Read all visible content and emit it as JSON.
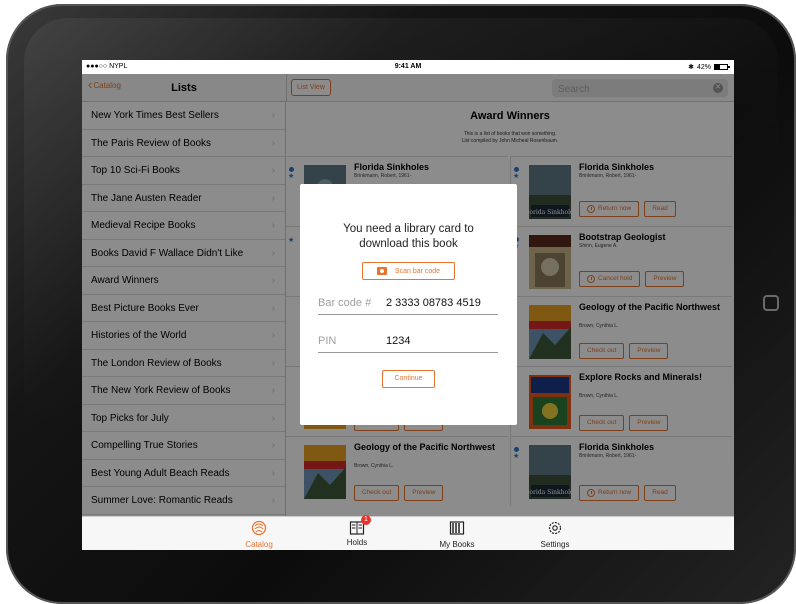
{
  "status_bar": {
    "carrier": "●●●○○ NYPL",
    "time": "9:41 AM",
    "battery": "42%"
  },
  "left_nav": {
    "back_label": "Catalog",
    "title": "Lists"
  },
  "right_nav": {
    "list_view_label": "List View",
    "search_placeholder": "Search"
  },
  "sidebar": {
    "items": [
      {
        "label": "New York Times Best Sellers"
      },
      {
        "label": "The Paris Review of Books"
      },
      {
        "label": "Top 10 Sci-Fi Books"
      },
      {
        "label": "The Jane Austen Reader"
      },
      {
        "label": "Medieval Recipe Books"
      },
      {
        "label": "Books David F Wallace Didn't Like"
      },
      {
        "label": "Award Winners"
      },
      {
        "label": "Best Picture Books Ever"
      },
      {
        "label": "Histories of the World"
      },
      {
        "label": "The London Review of Books"
      },
      {
        "label": "The New York Review of Books"
      },
      {
        "label": "Top Picks for July"
      },
      {
        "label": "Compelling True Stories"
      },
      {
        "label": "Best Young Adult Beach Reads"
      },
      {
        "label": "Summer Love: Romantic Reads"
      }
    ]
  },
  "main": {
    "title": "Award Winners",
    "subtitle_line1": "This is a list of books that won something.",
    "subtitle_line2": "List compiled by John Micheal Rosenbaum.",
    "books": [
      {
        "title": "Florida Sinkholes",
        "author": "Brinkmann, Robert, 1961-",
        "buttons": []
      },
      {
        "title": "Florida Sinkholes",
        "author": "Brinkmann, Robert, 1961-",
        "buttons": [
          "Return now",
          "Read"
        ]
      },
      {
        "title": "",
        "author": "",
        "buttons": []
      },
      {
        "title": "Bootstrap Geologist",
        "author": "Shinn, Eugene A.",
        "buttons": [
          "Cancel hold",
          "Preview"
        ]
      },
      {
        "title": "",
        "author": "",
        "buttons": []
      },
      {
        "title": "Geology of the Pacific Northwest",
        "author": "Brown, Cynthia L.",
        "buttons": [
          "Check out",
          "Preview"
        ]
      },
      {
        "title": "",
        "author": "",
        "buttons": [
          "Check out",
          "Preview"
        ]
      },
      {
        "title": "Explore Rocks and Minerals!",
        "author": "Brown, Cynthia L.",
        "buttons": [
          "Check out",
          "Preview"
        ]
      },
      {
        "title": "Geology of the Pacific Northwest",
        "author": "Brown, Cynthia L.",
        "buttons": [
          "Check out",
          "Preview"
        ]
      },
      {
        "title": "Florida Sinkholes",
        "author": "Brinkmann, Robert, 1961-",
        "buttons": [
          "Return now",
          "Read"
        ]
      }
    ]
  },
  "modal": {
    "message_line1": "You need a library card to",
    "message_line2": "download this book",
    "scan_label": "Scan bar code",
    "barcode_label": "Bar code #",
    "barcode_value": "2 3333 08783 4519",
    "pin_label": "PIN",
    "pin_value": "1234",
    "continue_label": "Continue"
  },
  "tabbar": {
    "tabs": [
      {
        "label": "Catalog",
        "icon": "catalog-icon",
        "active": true
      },
      {
        "label": "Holds",
        "icon": "holds-icon",
        "badge": "1"
      },
      {
        "label": "My Books",
        "icon": "my-books-icon"
      },
      {
        "label": "Settings",
        "icon": "settings-icon"
      }
    ]
  },
  "colors": {
    "accent": "#e8742f",
    "dot": "#2a78c8",
    "badge": "#e8322a"
  }
}
